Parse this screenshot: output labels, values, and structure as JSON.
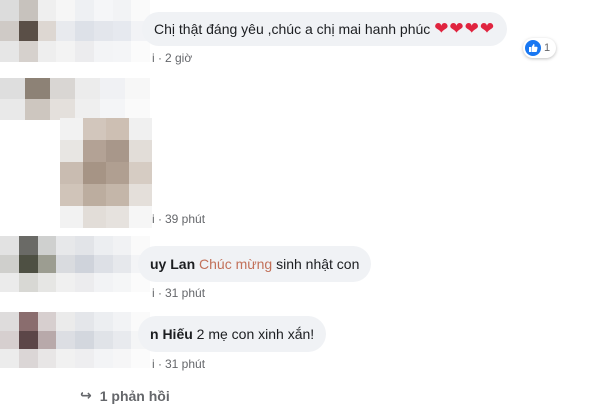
{
  "comments": [
    {
      "name": "",
      "text": "Chị thật đáng yêu ,chúc a chị mai hanh phúc",
      "hearts": "❤❤❤❤",
      "time": "2 giờ",
      "reaction_count": "1"
    },
    {
      "name": "",
      "text": "",
      "time": "39 phút"
    },
    {
      "name": "uy Lan",
      "tag": "Chúc mừng",
      "text": "sinh nhật con",
      "time": "31 phút"
    },
    {
      "name": "n Hiếu",
      "text": "2 mẹ con xinh xắn!",
      "time": "31 phút"
    }
  ],
  "reply_link": "1 phản hồi",
  "meta_sep": "i ·",
  "colors": {
    "bubble_bg": "#f0f2f5",
    "tag": "#c2715a",
    "like_blue": "#1877f2",
    "heart": "#e0243f"
  }
}
